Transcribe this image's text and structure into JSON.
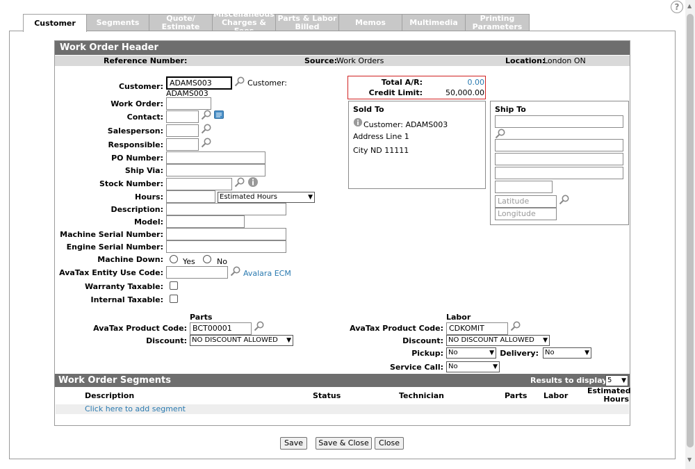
{
  "tabs": [
    {
      "label": "Customer"
    },
    {
      "label": "Segments"
    },
    {
      "label": "Quote/\nEstimate"
    },
    {
      "label": "Miscellaneous\nCharges & Fees"
    },
    {
      "label": "Parts & Labor\nBilled"
    },
    {
      "label": "Memos"
    },
    {
      "label": "Multimedia"
    },
    {
      "label": "Printing\nParameters"
    }
  ],
  "header": {
    "title": "Work Order Header",
    "reference_label": "Reference Number:",
    "source_label": "Source:",
    "source_value": "Work Orders",
    "location_label": "Location:",
    "location_value": "London ON"
  },
  "form": {
    "customer_label": "Customer:",
    "customer_value": "ADAMS003",
    "customer_lookup_label": "Customer:",
    "customer_lookup_value": "ADAMS003",
    "work_order_label": "Work Order:",
    "contact_label": "Contact:",
    "salesperson_label": "Salesperson:",
    "responsible_label": "Responsible:",
    "po_number_label": "PO Number:",
    "ship_via_label": "Ship Via:",
    "stock_number_label": "Stock Number:",
    "hours_label": "Hours:",
    "hours_type_value": "Estimated Hours",
    "description_label": "Description:",
    "model_label": "Model:",
    "machine_serial_label": "Machine Serial Number:",
    "engine_serial_label": "Engine Serial Number:",
    "machine_down_label": "Machine Down:",
    "yes_label": "Yes",
    "no_label": "No",
    "avatax_entity_label": "AvaTax Entity Use Code:",
    "avalara_link": "Avalara ECM",
    "warranty_taxable_label": "Warranty Taxable:",
    "internal_taxable_label": "Internal Taxable:"
  },
  "ar": {
    "total_label": "Total A/R:",
    "total_value": "0.00",
    "credit_label": "Credit Limit:",
    "credit_value": "50,000.00"
  },
  "sold_to": {
    "title": "Sold To",
    "customer_line": "Customer: ADAMS003",
    "address_line": "Address Line 1",
    "city_line": "City ND 11111"
  },
  "ship_to": {
    "title": "Ship To",
    "latitude_placeholder": "Latitude",
    "longitude_placeholder": "Longitude"
  },
  "parts": {
    "title": "Parts",
    "product_code_label": "AvaTax Product Code:",
    "product_code_value": "BCT00001",
    "discount_label": "Discount:",
    "discount_value": "NO DISCOUNT ALLOWED"
  },
  "labor": {
    "title": "Labor",
    "product_code_label": "AvaTax Product Code:",
    "product_code_value": "CDKOMIT",
    "discount_label": "Discount:",
    "discount_value": "NO DISCOUNT ALLOWED",
    "pickup_label": "Pickup:",
    "pickup_value": "No",
    "delivery_label": "Delivery:",
    "delivery_value": "No",
    "service_call_label": "Service Call:",
    "service_call_value": "No"
  },
  "segments": {
    "title": "Work Order Segments",
    "results_label": "Results to display:",
    "results_value": "5",
    "columns": [
      "Description",
      "Status",
      "Technician",
      "Parts",
      "Labor",
      "Estimated Hours"
    ],
    "add_link": "Click here to add segment"
  },
  "buttons": {
    "save": "Save",
    "save_close": "Save & Close",
    "close": "Close"
  },
  "help_icon": "?"
}
